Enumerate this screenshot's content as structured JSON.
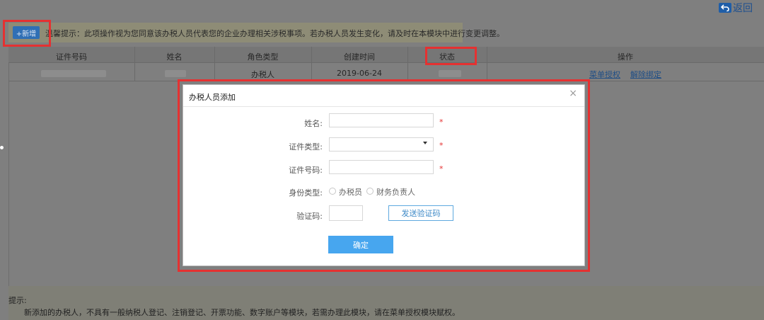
{
  "header": {
    "back_label": "返回"
  },
  "toolbar": {
    "add_label": "+新增",
    "notice": "温馨提示：此项操作视为您同意该办税人员代表您的企业办理相关涉税事项。若办税人员发生变化，请及时在本模块中进行变更调整。"
  },
  "table": {
    "headers": [
      "证件号码",
      "姓名",
      "角色类型",
      "创建时间",
      "状态",
      "操作"
    ],
    "rows": [
      {
        "role": "办税人",
        "created": "2019-06-24",
        "actions": [
          "菜单授权",
          "解除绑定"
        ]
      }
    ]
  },
  "modal": {
    "title": "办税人员添加",
    "close": "×",
    "fields": {
      "name_label": "姓名:",
      "id_type_label": "证件类型:",
      "id_number_label": "证件号码:",
      "identity_label": "身份类型:",
      "verify_label": "验证码:"
    },
    "identity_options": [
      "办税员",
      "财务负责人"
    ],
    "send_code_label": "发送验证码",
    "confirm_label": "确定",
    "required_mark": "*"
  },
  "bottom_tip": {
    "label": "提示:",
    "text": "新添加的办税人，不具有一般纳税人登记、注销登记、开票功能、数字账户等模块，若需办理此模块，请在菜单授权模块赋权。"
  },
  "colors": {
    "highlight": "#e53131",
    "primary": "#47a6ef",
    "link": "#1f4e86"
  }
}
